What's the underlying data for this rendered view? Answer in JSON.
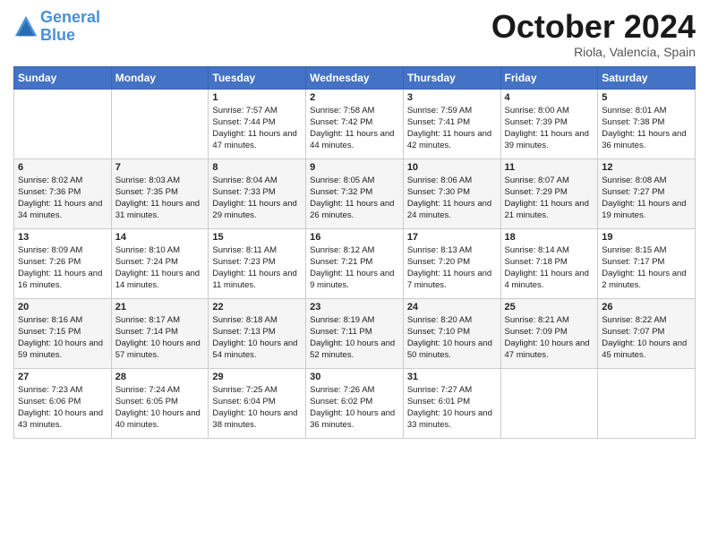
{
  "header": {
    "logo_line1": "General",
    "logo_line2": "Blue",
    "month": "October 2024",
    "location": "Riola, Valencia, Spain"
  },
  "days_of_week": [
    "Sunday",
    "Monday",
    "Tuesday",
    "Wednesday",
    "Thursday",
    "Friday",
    "Saturday"
  ],
  "weeks": [
    [
      {
        "day": "",
        "info": ""
      },
      {
        "day": "",
        "info": ""
      },
      {
        "day": "1",
        "info": "Sunrise: 7:57 AM\nSunset: 7:44 PM\nDaylight: 11 hours and 47 minutes."
      },
      {
        "day": "2",
        "info": "Sunrise: 7:58 AM\nSunset: 7:42 PM\nDaylight: 11 hours and 44 minutes."
      },
      {
        "day": "3",
        "info": "Sunrise: 7:59 AM\nSunset: 7:41 PM\nDaylight: 11 hours and 42 minutes."
      },
      {
        "day": "4",
        "info": "Sunrise: 8:00 AM\nSunset: 7:39 PM\nDaylight: 11 hours and 39 minutes."
      },
      {
        "day": "5",
        "info": "Sunrise: 8:01 AM\nSunset: 7:38 PM\nDaylight: 11 hours and 36 minutes."
      }
    ],
    [
      {
        "day": "6",
        "info": "Sunrise: 8:02 AM\nSunset: 7:36 PM\nDaylight: 11 hours and 34 minutes."
      },
      {
        "day": "7",
        "info": "Sunrise: 8:03 AM\nSunset: 7:35 PM\nDaylight: 11 hours and 31 minutes."
      },
      {
        "day": "8",
        "info": "Sunrise: 8:04 AM\nSunset: 7:33 PM\nDaylight: 11 hours and 29 minutes."
      },
      {
        "day": "9",
        "info": "Sunrise: 8:05 AM\nSunset: 7:32 PM\nDaylight: 11 hours and 26 minutes."
      },
      {
        "day": "10",
        "info": "Sunrise: 8:06 AM\nSunset: 7:30 PM\nDaylight: 11 hours and 24 minutes."
      },
      {
        "day": "11",
        "info": "Sunrise: 8:07 AM\nSunset: 7:29 PM\nDaylight: 11 hours and 21 minutes."
      },
      {
        "day": "12",
        "info": "Sunrise: 8:08 AM\nSunset: 7:27 PM\nDaylight: 11 hours and 19 minutes."
      }
    ],
    [
      {
        "day": "13",
        "info": "Sunrise: 8:09 AM\nSunset: 7:26 PM\nDaylight: 11 hours and 16 minutes."
      },
      {
        "day": "14",
        "info": "Sunrise: 8:10 AM\nSunset: 7:24 PM\nDaylight: 11 hours and 14 minutes."
      },
      {
        "day": "15",
        "info": "Sunrise: 8:11 AM\nSunset: 7:23 PM\nDaylight: 11 hours and 11 minutes."
      },
      {
        "day": "16",
        "info": "Sunrise: 8:12 AM\nSunset: 7:21 PM\nDaylight: 11 hours and 9 minutes."
      },
      {
        "day": "17",
        "info": "Sunrise: 8:13 AM\nSunset: 7:20 PM\nDaylight: 11 hours and 7 minutes."
      },
      {
        "day": "18",
        "info": "Sunrise: 8:14 AM\nSunset: 7:18 PM\nDaylight: 11 hours and 4 minutes."
      },
      {
        "day": "19",
        "info": "Sunrise: 8:15 AM\nSunset: 7:17 PM\nDaylight: 11 hours and 2 minutes."
      }
    ],
    [
      {
        "day": "20",
        "info": "Sunrise: 8:16 AM\nSunset: 7:15 PM\nDaylight: 10 hours and 59 minutes."
      },
      {
        "day": "21",
        "info": "Sunrise: 8:17 AM\nSunset: 7:14 PM\nDaylight: 10 hours and 57 minutes."
      },
      {
        "day": "22",
        "info": "Sunrise: 8:18 AM\nSunset: 7:13 PM\nDaylight: 10 hours and 54 minutes."
      },
      {
        "day": "23",
        "info": "Sunrise: 8:19 AM\nSunset: 7:11 PM\nDaylight: 10 hours and 52 minutes."
      },
      {
        "day": "24",
        "info": "Sunrise: 8:20 AM\nSunset: 7:10 PM\nDaylight: 10 hours and 50 minutes."
      },
      {
        "day": "25",
        "info": "Sunrise: 8:21 AM\nSunset: 7:09 PM\nDaylight: 10 hours and 47 minutes."
      },
      {
        "day": "26",
        "info": "Sunrise: 8:22 AM\nSunset: 7:07 PM\nDaylight: 10 hours and 45 minutes."
      }
    ],
    [
      {
        "day": "27",
        "info": "Sunrise: 7:23 AM\nSunset: 6:06 PM\nDaylight: 10 hours and 43 minutes."
      },
      {
        "day": "28",
        "info": "Sunrise: 7:24 AM\nSunset: 6:05 PM\nDaylight: 10 hours and 40 minutes."
      },
      {
        "day": "29",
        "info": "Sunrise: 7:25 AM\nSunset: 6:04 PM\nDaylight: 10 hours and 38 minutes."
      },
      {
        "day": "30",
        "info": "Sunrise: 7:26 AM\nSunset: 6:02 PM\nDaylight: 10 hours and 36 minutes."
      },
      {
        "day": "31",
        "info": "Sunrise: 7:27 AM\nSunset: 6:01 PM\nDaylight: 10 hours and 33 minutes."
      },
      {
        "day": "",
        "info": ""
      },
      {
        "day": "",
        "info": ""
      }
    ]
  ]
}
